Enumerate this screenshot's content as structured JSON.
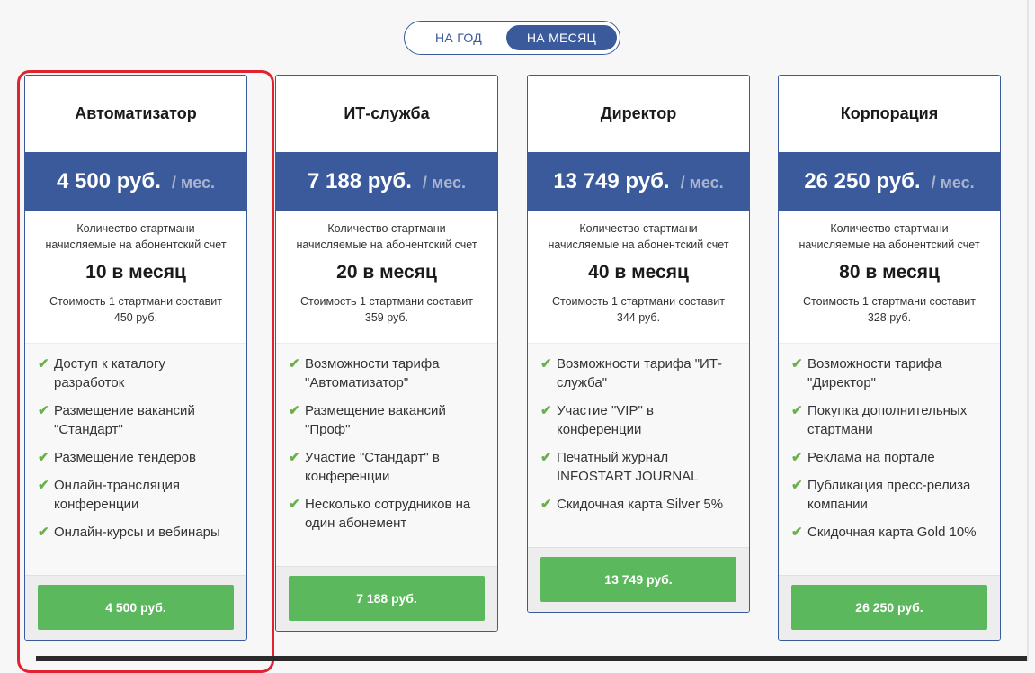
{
  "toggle": {
    "year_label": "НА ГОД",
    "month_label": "НА МЕСЯЦ"
  },
  "plans": [
    {
      "title": "Автоматизатор",
      "price": "4 500 руб.",
      "unit": "/ мес.",
      "desc": "Количество стартмани начисляемые на абонентский счет",
      "amount": "10 в месяц",
      "cost": "Стоимость 1 стартмани составит 450 руб.",
      "features": [
        "Доступ к каталогу разработок",
        "Размещение вакансий \"Стандарт\"",
        "Размещение тендеров",
        "Онлайн-трансляция конференции",
        "Онлайн-курсы и вебинары"
      ],
      "button": "4 500 руб."
    },
    {
      "title": "ИТ-служба",
      "price": "7 188 руб.",
      "unit": "/ мес.",
      "desc": "Количество стартмани начисляемые на абонентский счет",
      "amount": "20 в месяц",
      "cost": "Стоимость 1 стартмани составит 359 руб.",
      "features": [
        "Возможности тарифа \"Автоматизатор\"",
        "Размещение вакансий \"Проф\"",
        "Участие \"Стандарт\" в конференции",
        "Несколько сотрудников на один абонемент"
      ],
      "button": "7 188 руб."
    },
    {
      "title": "Директор",
      "price": "13 749 руб.",
      "unit": "/ мес.",
      "desc": "Количество стартмани начисляемые на абонентский счет",
      "amount": "40 в месяц",
      "cost": "Стоимость 1 стартмани составит 344 руб.",
      "features": [
        "Возможности тарифа \"ИТ-служба\"",
        "Участие \"VIP\" в конференции",
        "Печатный журнал INFOSTART JOURNAL",
        "Скидочная карта Silver 5%"
      ],
      "button": "13 749 руб."
    },
    {
      "title": "Корпорация",
      "price": "26 250 руб.",
      "unit": "/ мес.",
      "desc": "Количество стартмани начисляемые на абонентский счет",
      "amount": "80 в месяц",
      "cost": "Стоимость 1 стартмани составит 328 руб.",
      "features": [
        "Возможности тарифа \"Директор\"",
        "Покупка дополнительных стартмани",
        "Реклама на портале",
        "Публикация пресс-релиза компании",
        "Скидочная карта Gold 10%"
      ],
      "button": "26 250 руб."
    }
  ],
  "colors": {
    "brand_blue": "#3a5a9c",
    "button_green": "#5cb85c",
    "check_green": "#6ab04c",
    "highlight_red": "#e1232f"
  },
  "icons": {
    "check": "checkmark-icon"
  }
}
